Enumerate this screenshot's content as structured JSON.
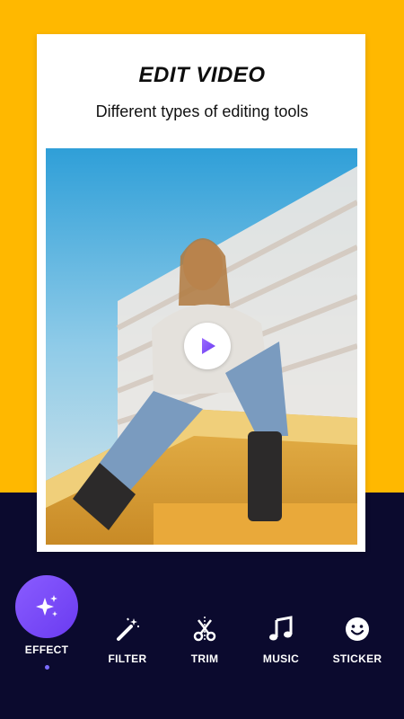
{
  "header": {
    "title": "EDIT VIDEO",
    "subtitle": "Different types of editing tools"
  },
  "colors": {
    "top_background": "#FFB800",
    "bottom_background": "#0B0A2E",
    "accent": "#7B5CFF"
  },
  "video": {
    "play_icon": "play-icon"
  },
  "tools": [
    {
      "label": "EFFECT",
      "icon": "sparkles-icon",
      "selected": true
    },
    {
      "label": "FILTER",
      "icon": "magic-wand-icon",
      "selected": false
    },
    {
      "label": "TRIM",
      "icon": "scissors-icon",
      "selected": false
    },
    {
      "label": "MUSIC",
      "icon": "music-note-icon",
      "selected": false
    },
    {
      "label": "STICKER",
      "icon": "smiley-icon",
      "selected": false
    }
  ]
}
